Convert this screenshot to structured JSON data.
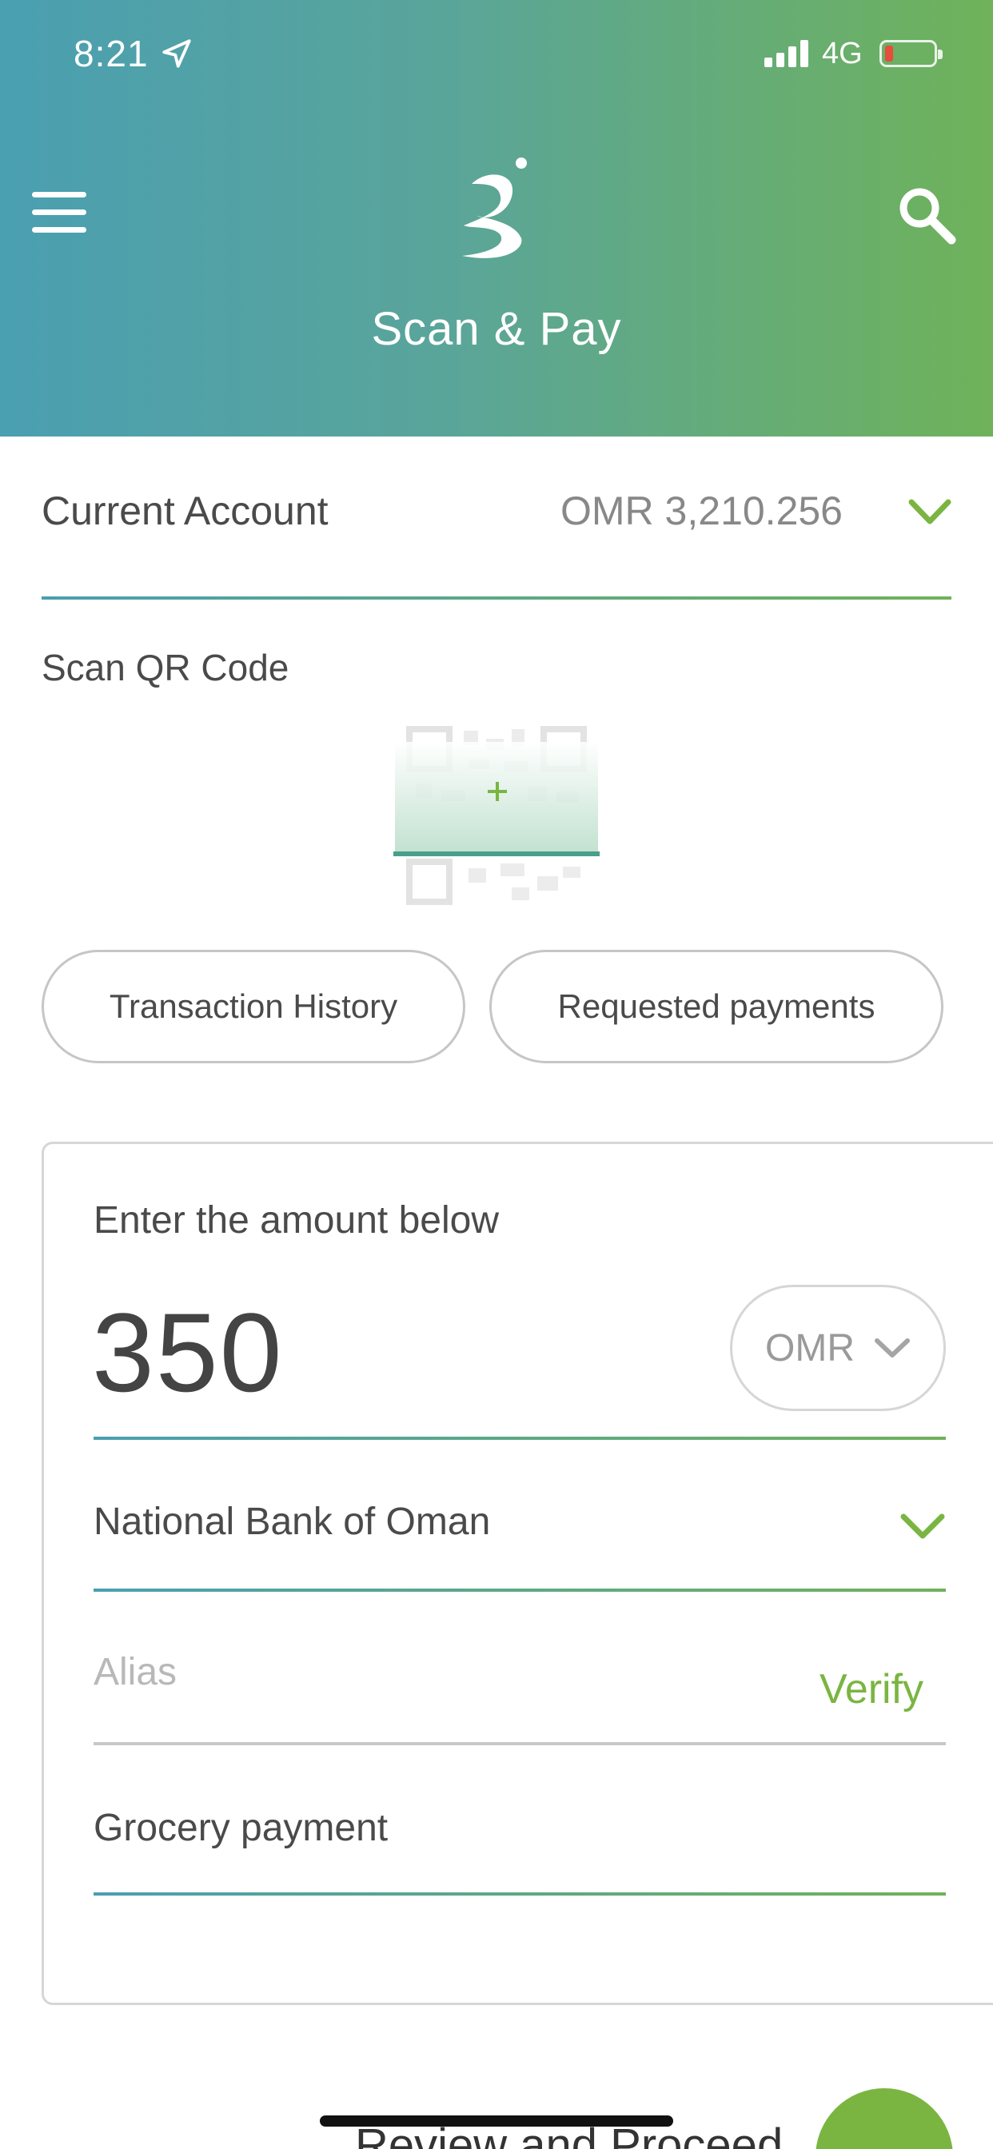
{
  "status_bar": {
    "time": "8:21",
    "network": "4G"
  },
  "header": {
    "title": "Scan & Pay"
  },
  "account": {
    "label": "Current Account",
    "balance": "OMR 3,210.256"
  },
  "scan": {
    "label": "Scan QR Code"
  },
  "actions": {
    "history": "Transaction History",
    "requested": "Requested payments"
  },
  "payment": {
    "prompt": "Enter the amount below",
    "amount": "350",
    "currency": "OMR",
    "bank": "National Bank of Oman",
    "alias_placeholder": "Alias",
    "verify_label": "Verify",
    "note": "Grocery payment"
  },
  "footer": {
    "proceed_label": "Review and Proceed"
  },
  "colors": {
    "accent_green": "#7ab541",
    "accent_teal": "#4a9fb1"
  }
}
